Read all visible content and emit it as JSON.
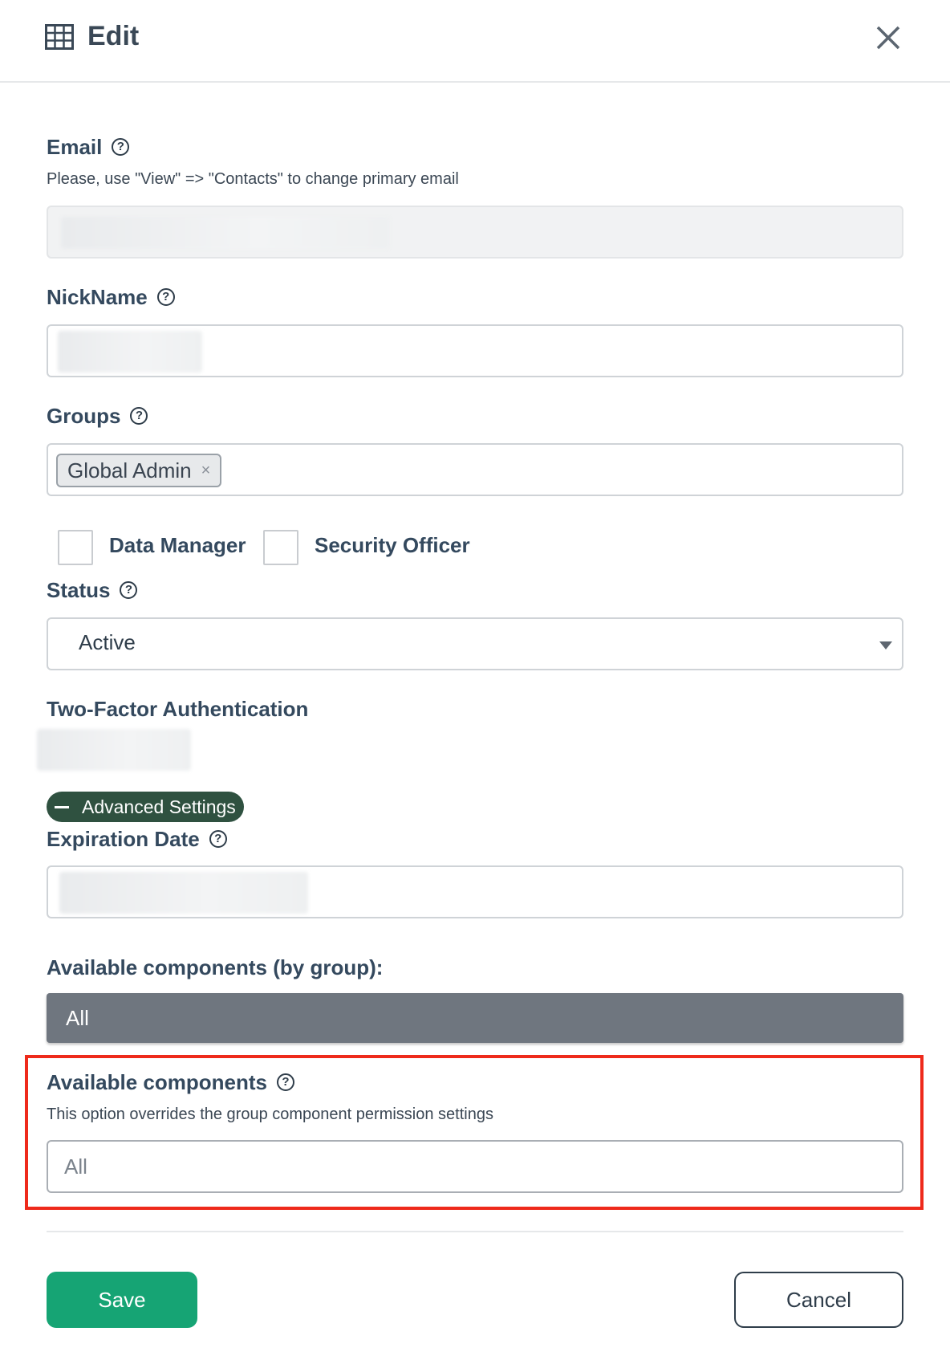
{
  "header": {
    "title": "Edit",
    "title_icon": "table-grid-icon",
    "close_icon": "close-icon"
  },
  "email": {
    "label": "Email",
    "hint": "Please, use \"View\" => \"Contacts\" to change primary email",
    "value": ""
  },
  "nickname": {
    "label": "NickName",
    "value": ""
  },
  "groups": {
    "label": "Groups",
    "tags": [
      "Global Admin"
    ],
    "tag_remove_glyph": "×"
  },
  "roles": {
    "data_manager": "Data Manager",
    "security_officer": "Security Officer"
  },
  "status": {
    "label": "Status",
    "value": "Active"
  },
  "two_factor": {
    "label": "Two-Factor Authentication",
    "value": ""
  },
  "advanced": {
    "toggle_label": "Advanced Settings"
  },
  "expiration": {
    "label": "Expiration Date",
    "value": ""
  },
  "components_by_group": {
    "label": "Available components (by group):",
    "value": "All"
  },
  "available_components": {
    "label": "Available components",
    "hint": "This option overrides the group component permission settings",
    "placeholder": "All"
  },
  "footer": {
    "save_label": "Save",
    "cancel_label": "Cancel"
  },
  "colors": {
    "save": "#16a474",
    "advanced_toggle": "#2f5140",
    "highlight_box": "#ee2a1b",
    "group_bar": "#6f767f"
  }
}
